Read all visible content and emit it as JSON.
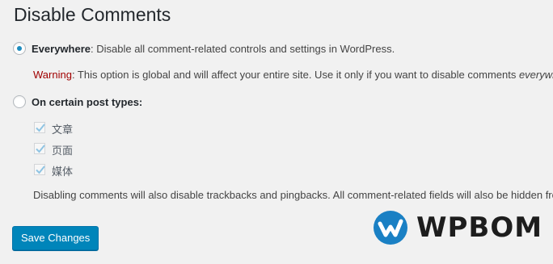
{
  "page": {
    "title": "Disable Comments"
  },
  "everywhere_option": {
    "label": "Everywhere",
    "description": ": Disable all comment-related controls and settings in WordPress."
  },
  "warning": {
    "label": "Warning",
    "text": ": This option is global and will affect your entire site. Use it only if you want to disable comments ",
    "emphasis": "everywhere"
  },
  "post_types_option": {
    "label": "On certain post types:"
  },
  "post_types": [
    {
      "label": "文章",
      "checked": true
    },
    {
      "label": "页面",
      "checked": true
    },
    {
      "label": "媒体",
      "checked": true
    }
  ],
  "note": "Disabling comments will also disable trackbacks and pingbacks. All comment-related fields will also be hidden from",
  "save_button": {
    "label": "Save Changes"
  },
  "watermark": {
    "text": "WPBOM",
    "icon": "w-check-logo-icon"
  },
  "colors": {
    "accent": "#0085ba",
    "warning": "#a00000",
    "watermark_blue": "#1a80c4"
  }
}
